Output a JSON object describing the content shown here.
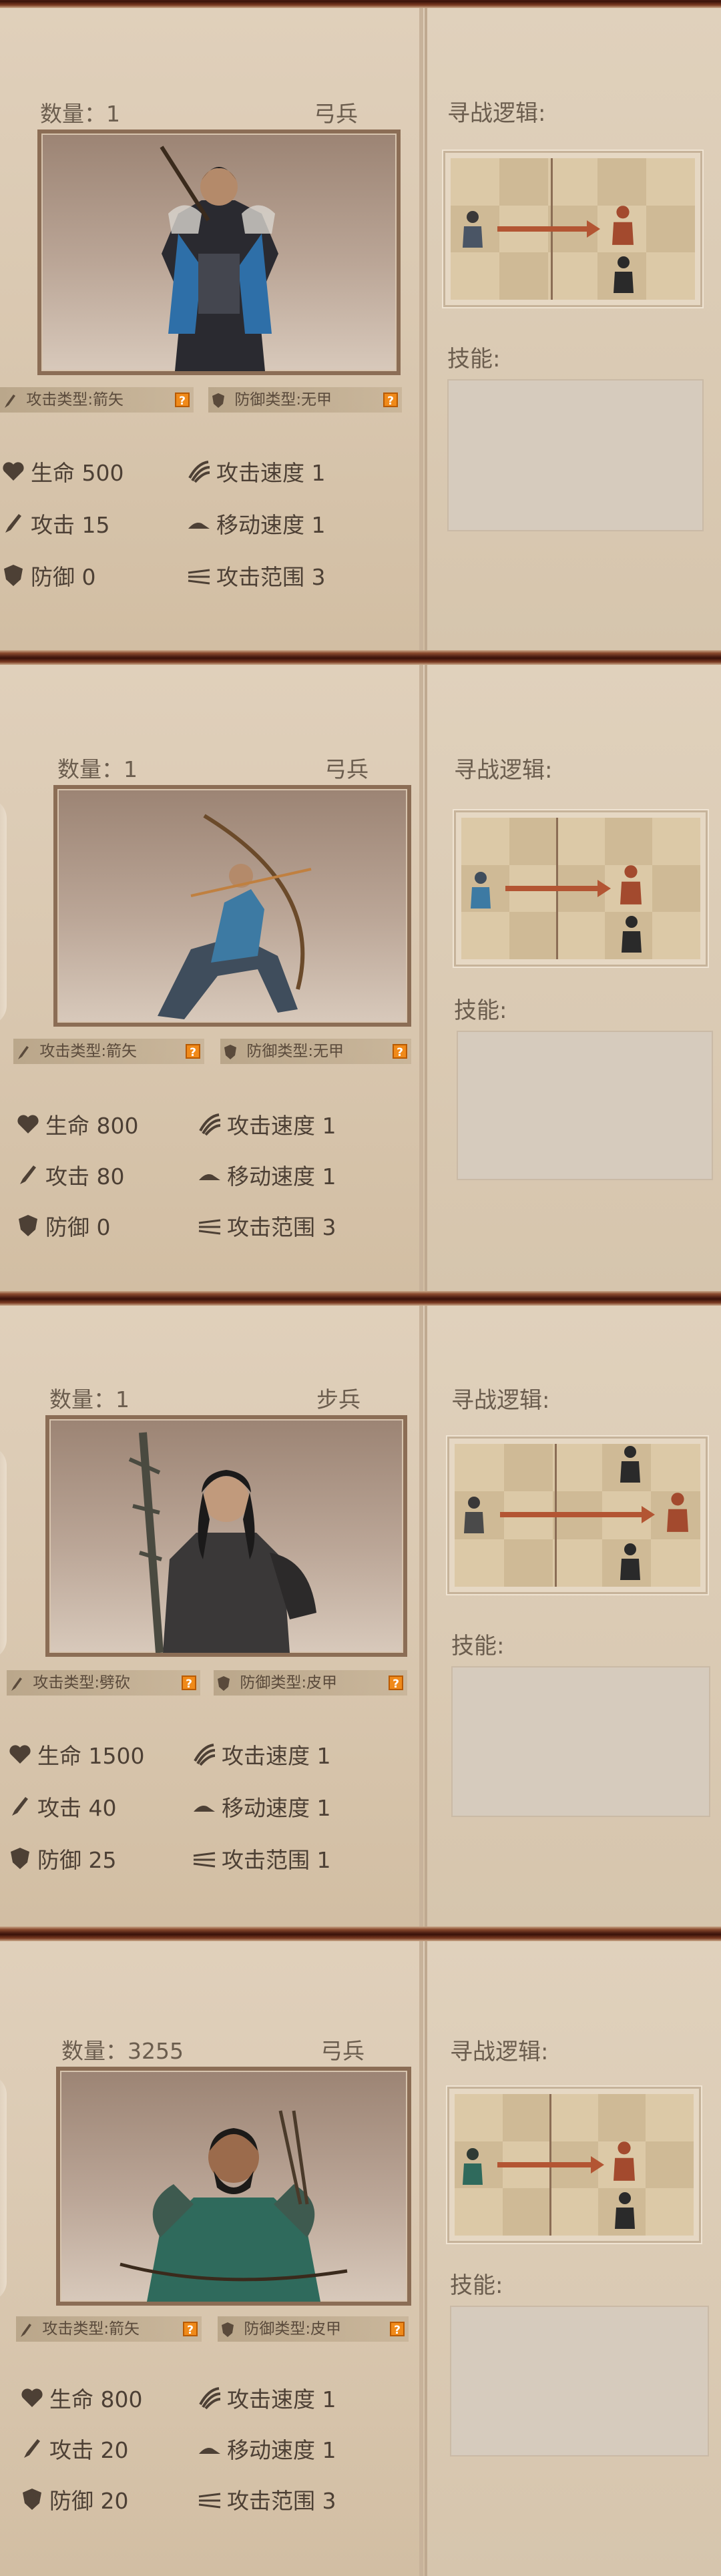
{
  "units": [
    {
      "count_label": "数量：1",
      "unit_type": "弓兵",
      "attack_type": "攻击类型:箭矢",
      "defense_type": "防御类型:无甲",
      "hp": "生命 500",
      "attack": "攻击 15",
      "defense": "防御 0",
      "attack_speed": "攻击速度 1",
      "move_speed": "移动速度 1",
      "attack_range": "攻击范围 3",
      "search_logic_label": "寻战逻辑:",
      "skills_label": "技能:",
      "armor_color": "#2e6fa8",
      "side_text": ""
    },
    {
      "count_label": "数量：1",
      "unit_type": "弓兵",
      "attack_type": "攻击类型:箭矢",
      "defense_type": "防御类型:无甲",
      "hp": "生命 800",
      "attack": "攻击 80",
      "defense": "防御 0",
      "attack_speed": "攻击速度 1",
      "move_speed": "移动速度 1",
      "attack_range": "攻击范围 3",
      "search_logic_label": "寻战逻辑:",
      "skills_label": "技能:",
      "armor_color": "#3d7aa3",
      "side_text": ""
    },
    {
      "count_label": "数量：1",
      "unit_type": "步兵",
      "attack_type": "攻击类型:劈砍",
      "defense_type": "防御类型:皮甲",
      "hp": "生命 1500",
      "attack": "攻击 40",
      "defense": "防御 25",
      "attack_speed": "攻击速度 1",
      "move_speed": "移动速度 1",
      "attack_range": "攻击范围 1",
      "search_logic_label": "寻战逻辑:",
      "skills_label": "技能:",
      "armor_color": "#3a3838",
      "side_text": ""
    },
    {
      "count_label": "数量：3255",
      "unit_type": "弓兵",
      "attack_type": "攻击类型:箭矢",
      "defense_type": "防御类型:皮甲",
      "hp": "生命 800",
      "attack": "攻击 20",
      "defense": "防御 20",
      "attack_speed": "攻击速度 1",
      "move_speed": "移动速度 1",
      "attack_range": "攻击范围 3",
      "search_logic_label": "寻战逻辑:",
      "skills_label": "技能:",
      "armor_color": "#2f6a5c",
      "side_text": ""
    }
  ],
  "colors": {
    "frame_dark": "#3a1209",
    "panel": "#dccbb5",
    "enemy_red": "#a34a2e",
    "arrow": "#b35533",
    "help_badge": "#f08a1a"
  },
  "icons": {
    "hp": "heart-icon",
    "attack": "sword-icon",
    "defense": "shield-icon",
    "attack_speed": "claw-icon",
    "move_speed": "boot-icon",
    "attack_range": "range-icon",
    "help": "question-icon"
  }
}
